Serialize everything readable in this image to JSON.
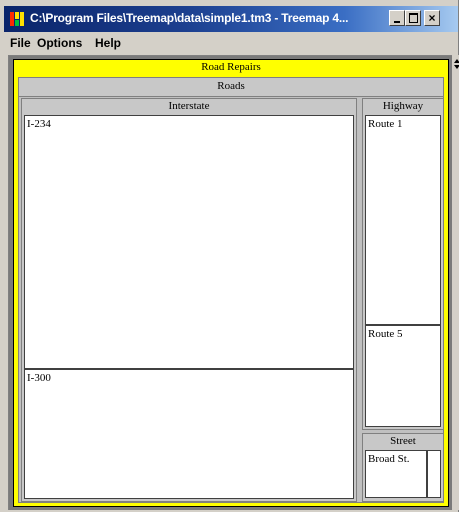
{
  "window": {
    "title": "C:\\Program Files\\Treemap\\data\\simple1.tm3 - Treemap 4...",
    "close_glyph": "×"
  },
  "menu": {
    "items": [
      "File",
      "Options",
      "Help"
    ]
  },
  "treemap": {
    "root_label": "Road Repairs",
    "group_label": "Roads",
    "categories": {
      "interstate": {
        "label": "Interstate",
        "items": [
          "I-234",
          "I-300"
        ]
      },
      "highway": {
        "label": "Highway",
        "items": [
          "Route 1",
          "Route 5"
        ]
      },
      "street": {
        "label": "Street",
        "items": [
          "Broad St."
        ]
      }
    }
  },
  "colors": {
    "title_bar": "#0a246a",
    "root_highlight": "#ffff00",
    "leaf_fill": "#ffffff",
    "frame": "#7a7a7a"
  }
}
